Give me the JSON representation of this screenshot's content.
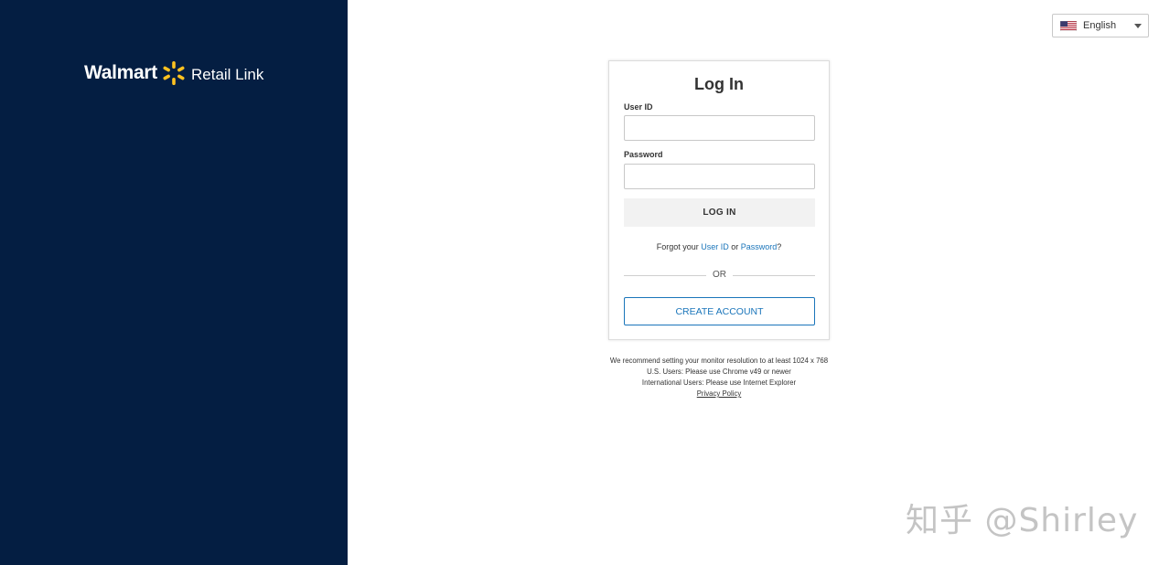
{
  "brand": {
    "name": "Walmart",
    "product": "Retail Link",
    "side_panel_color": "#041e42",
    "spark_color": "#ffc220",
    "link_color": "#1a75ba"
  },
  "language": {
    "selected": "English",
    "flag_icon": "us-flag-icon",
    "caret_icon": "caret-down-icon"
  },
  "login": {
    "title": "Log In",
    "user_id_label": "User ID",
    "user_id_value": "",
    "password_label": "Password",
    "password_value": "",
    "login_button": "LOG IN",
    "forgot_prefix": "Forgot your ",
    "forgot_user_id": "User ID",
    "forgot_or": " or ",
    "forgot_password": "Password",
    "forgot_suffix": "?",
    "or_divider": "OR",
    "create_account": "CREATE ACCOUNT"
  },
  "notes": {
    "resolution": "We recommend setting your monitor resolution to at least 1024 x 768",
    "us_users": "U.S. Users: Please use Chrome v49 or newer",
    "intl_users": "International Users: Please use Internet Explorer",
    "privacy": "Privacy Policy"
  },
  "watermark": "知乎 @Shirley"
}
